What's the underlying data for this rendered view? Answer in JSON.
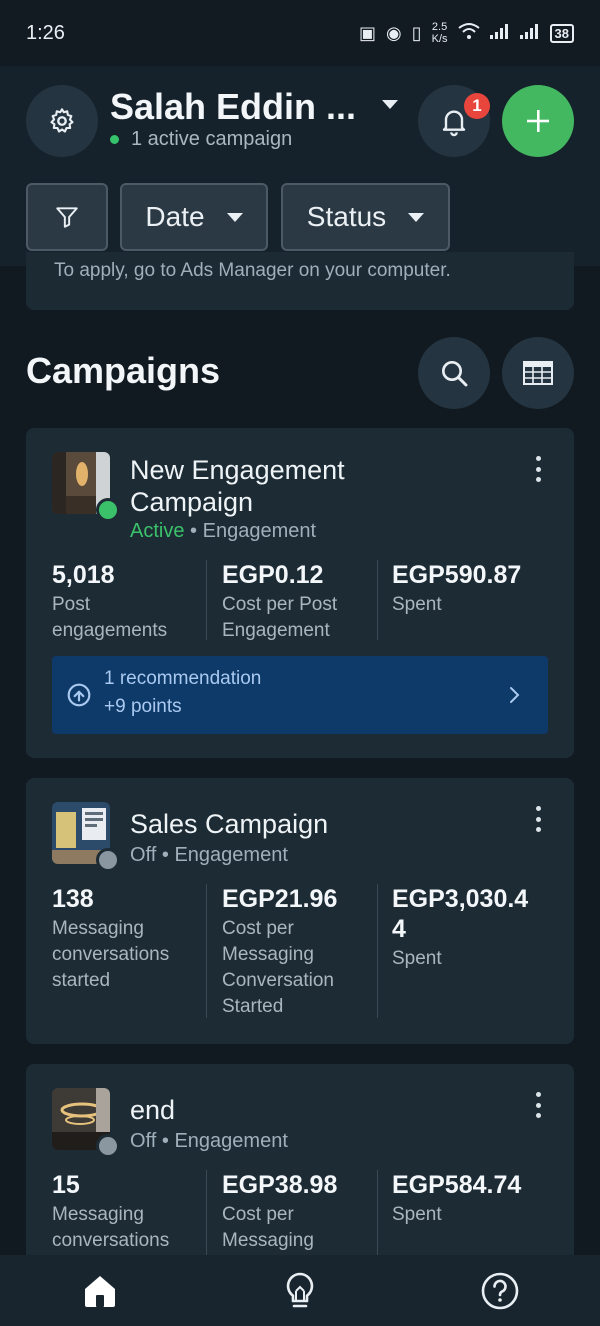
{
  "status_bar": {
    "time": "1:26",
    "net_speed_top": "2.5",
    "net_speed_unit": "K/s",
    "battery": "38"
  },
  "header": {
    "account_name": "Salah Eddin ...",
    "active_campaigns": "1 active campaign",
    "notification_count": "1",
    "icons": {
      "settings": "gear-icon",
      "notifications": "bell-icon",
      "create": "plus-icon",
      "account_dropdown": "caret-down-icon"
    }
  },
  "filters": {
    "filter_icon": "filter-icon",
    "date_label": "Date",
    "status_label": "Status"
  },
  "info_strip": {
    "text": "To apply, go to Ads Manager on your computer."
  },
  "campaigns_section": {
    "title": "Campaigns",
    "search_icon": "search-icon",
    "table_icon": "table-icon"
  },
  "campaigns": [
    {
      "name": "New Engagement Campaign",
      "status": "Active",
      "objective": "Engagement",
      "status_color": "#3bc16a",
      "metrics": [
        {
          "value": "5,018",
          "label": "Post engagements"
        },
        {
          "value": "EGP0.12",
          "label": "Cost per Post Engagement"
        },
        {
          "value": "EGP590.87",
          "label": "Spent"
        }
      ],
      "recommendation": {
        "title": "1 recommendation",
        "points": "+9 points"
      }
    },
    {
      "name": "Sales Campaign",
      "status": "Off",
      "objective": "Engagement",
      "status_color": "#8a97a0",
      "metrics": [
        {
          "value": "138",
          "label": "Messaging conversations started"
        },
        {
          "value": "EGP21.96",
          "label": "Cost per Messaging Conversation Started"
        },
        {
          "value": "EGP3,030.44",
          "label": "Spent"
        }
      ]
    },
    {
      "name": "end",
      "status": "Off",
      "objective": "Engagement",
      "status_color": "#8a97a0",
      "metrics": [
        {
          "value": "15",
          "label": "Messaging conversations"
        },
        {
          "value": "EGP38.98",
          "label": "Cost per Messaging"
        },
        {
          "value": "EGP584.74",
          "label": "Spent"
        }
      ]
    }
  ],
  "separator": "•",
  "bottom_nav": [
    {
      "name": "home",
      "icon": "home-icon"
    },
    {
      "name": "ideas",
      "icon": "lightbulb-icon"
    },
    {
      "name": "help",
      "icon": "help-icon"
    }
  ],
  "colors": {
    "background": "#111a21",
    "card": "#1d2b35",
    "accent_green": "#44b861",
    "recommendation_bg": "#0e3a69",
    "badge_red": "#e8453c"
  }
}
